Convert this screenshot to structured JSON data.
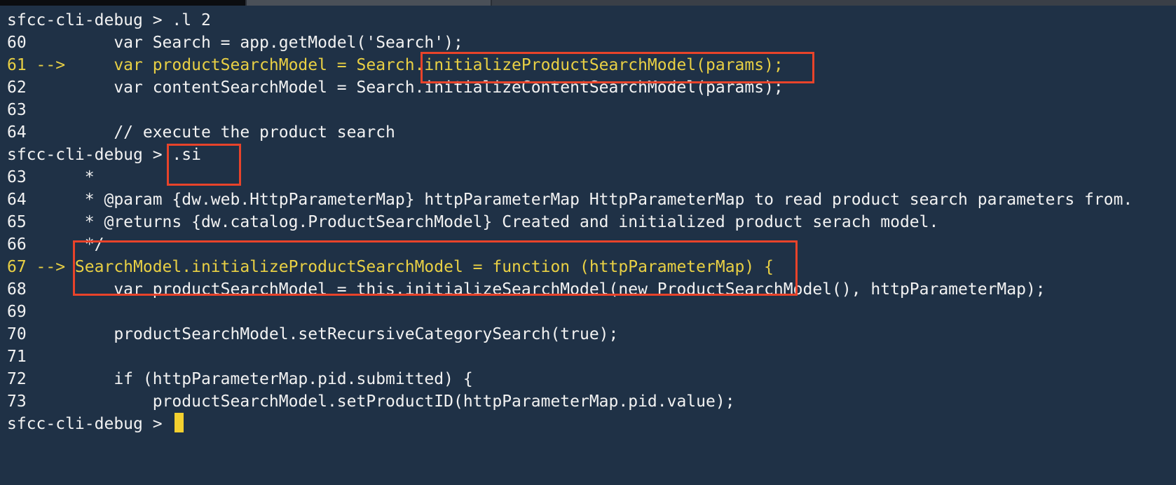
{
  "lines": [
    {
      "text": "sfcc-cli-debug > .l 2"
    },
    {
      "text": "60         var Search = app.getModel('Search');"
    },
    {
      "text": "61 -->     var productSearchModel = Search.initializeProductSearchModel(params);",
      "current": true
    },
    {
      "text": "62         var contentSearchModel = Search.initializeContentSearchModel(params);"
    },
    {
      "text": "63"
    },
    {
      "text": "64         // execute the product search"
    },
    {
      "text": "sfcc-cli-debug > .si"
    },
    {
      "text": "63      *"
    },
    {
      "text": "64      * @param {dw.web.HttpParameterMap} httpParameterMap HttpParameterMap to read product search parameters from."
    },
    {
      "text": "65      * @returns {dw.catalog.ProductSearchModel} Created and initialized product serach model."
    },
    {
      "text": "66      */"
    },
    {
      "text": "67 --> SearchModel.initializeProductSearchModel = function (httpParameterMap) {",
      "current": true
    },
    {
      "text": "68         var productSearchModel = this.initializeSearchModel(new ProductSearchModel(), httpParameterMap);"
    },
    {
      "text": "69"
    },
    {
      "text": "70         productSearchModel.setRecursiveCategorySearch(true);"
    },
    {
      "text": "71"
    },
    {
      "text": "72         if (httpParameterMap.pid.submitted) {"
    },
    {
      "text": "73             productSearchModel.setProductID(httpParameterMap.pid.value);"
    }
  ],
  "prompt": {
    "text": "sfcc-cli-debug > "
  },
  "colors": {
    "background": "#1f3146",
    "text": "#f2f2f2",
    "current_line": "#e9d044",
    "highlight_box": "#e8432a",
    "cursor": "#f3d02f"
  }
}
